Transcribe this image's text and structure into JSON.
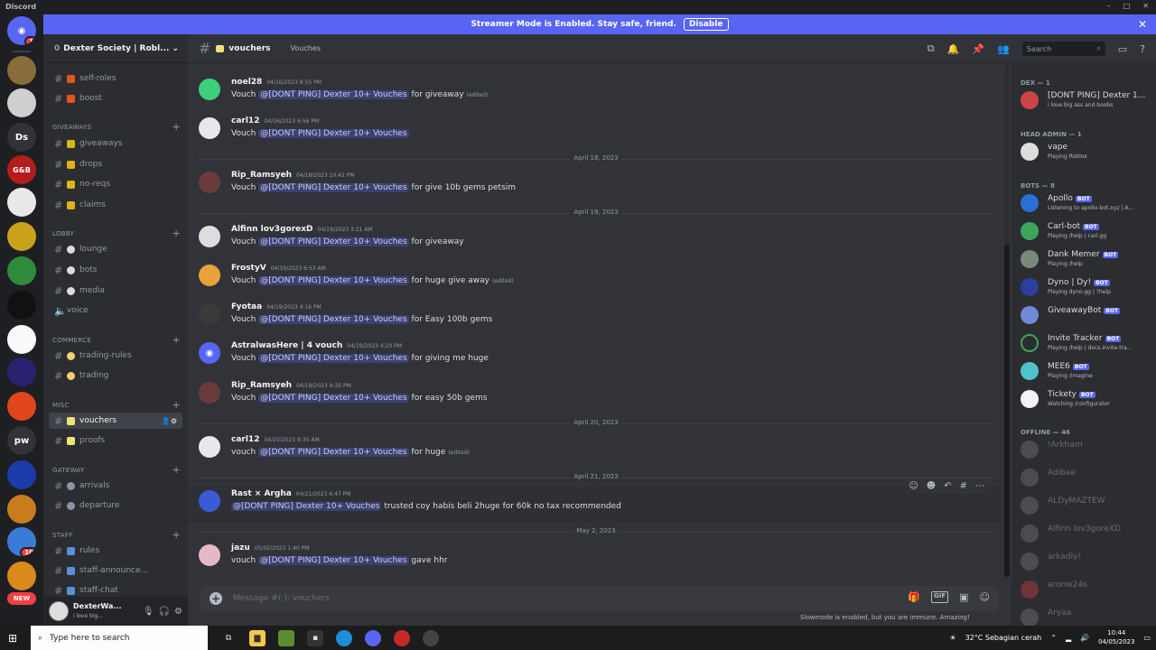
{
  "window": {
    "app_name": "Discord",
    "controls": [
      "–",
      "□",
      "✕"
    ]
  },
  "banner": {
    "text": "Streamer Mode is Enabled. Stay safe, friend.",
    "button": "Disable"
  },
  "server": {
    "name": "Dexter Society | Robl...",
    "mention_count": "0"
  },
  "guild_badges": {
    "home": "1",
    "red1": "10",
    "new": "NEW"
  },
  "guild_labels": {
    "ds": "Ds",
    "pw": "pw",
    "gb": "G&B"
  },
  "channels": [
    {
      "label": "self-roles"
    },
    {
      "label": "boost"
    },
    {
      "label": "giveaways"
    },
    {
      "label": "drops"
    },
    {
      "label": "no-reqs"
    },
    {
      "label": "claims"
    },
    {
      "label": "lounge"
    },
    {
      "label": "bots"
    },
    {
      "label": "media"
    },
    {
      "label": "voice"
    },
    {
      "label": "trading-rules"
    },
    {
      "label": "trading"
    },
    {
      "label": "vouchers"
    },
    {
      "label": "proofs"
    },
    {
      "label": "arrivals"
    },
    {
      "label": "departure"
    },
    {
      "label": "rules"
    },
    {
      "label": "staff-announce..."
    },
    {
      "label": "staff-chat"
    }
  ],
  "categories": {
    "giveaways": "GIVEAWAYS",
    "lobby": "LOBBY",
    "commerce": "COMMERCE",
    "misc": "MISC",
    "gateway": "GATEWAY",
    "staff": "STAFF"
  },
  "user": {
    "name": "DexterWa...",
    "status": "i love big..."
  },
  "chat": {
    "channel": "vouchers",
    "topic": "Vouches",
    "search_placeholder": "Search"
  },
  "mention_text": "@[DONT PING] Dexter 10+ Vouches",
  "edited_label": "(edited)",
  "messages": [
    {
      "user": "noel28",
      "time": "04/16/2023 6:55 PM",
      "prefix": "Vouch",
      "suffix": "for giveaway",
      "edited": true
    },
    {
      "user": "carl12",
      "time": "04/16/2023 6:56 PM",
      "prefix": "Vouch",
      "suffix": "",
      "edited": false
    },
    {
      "user": "Rip_Ramsyeh",
      "time": "04/18/2023 10:42 PM",
      "prefix": "Vouch",
      "suffix": "for give 10b gems petsim",
      "edited": false
    },
    {
      "user": "Alfinn lov3gorexD",
      "time": "04/19/2023 3:21 AM",
      "prefix": "Vouch",
      "suffix": "for giveaway",
      "edited": false
    },
    {
      "user": "FrostyV",
      "time": "04/19/2023 6:53 AM",
      "prefix": "Vouch",
      "suffix": "for huge give away",
      "edited": true
    },
    {
      "user": "Fyotaa",
      "time": "04/19/2023 4:16 PM",
      "prefix": "Vouch",
      "suffix": "for Easy 100b gems",
      "edited": false
    },
    {
      "user": "AstralwasHere | 4 vouch",
      "time": "04/19/2023 4:20 PM",
      "prefix": "Vouch",
      "suffix": "for giving me huge",
      "edited": false
    },
    {
      "user": "Rip_Ramsyeh",
      "time": "04/19/2023 4:35 PM",
      "prefix": "Vouch",
      "suffix": "for easy 50b gems",
      "edited": false
    },
    {
      "user": "carl12",
      "time": "04/20/2023 9:35 AM",
      "prefix": "vouch",
      "suffix": "for huge",
      "edited": true
    },
    {
      "user": "Rast × Argha",
      "time": "04/21/2023 6:47 PM",
      "prefix": "",
      "suffix": "trusted coy habis beli 2huge for 60k no tax recommended",
      "edited": false
    },
    {
      "user": "jazu",
      "time": "05/02/2023 1:40 PM",
      "prefix": "vouch",
      "suffix": "gave hhr",
      "edited": false
    }
  ],
  "dividers": [
    "April 18, 2023",
    "April 19, 2023",
    "April 20, 2023",
    "April 21, 2023",
    "May 2, 2023"
  ],
  "composer": {
    "placeholder": "Message #(     ): vouchers",
    "gif": "GIF"
  },
  "slowmode": "Slowmode is enabled, but you are immune. Amazing!",
  "members": {
    "dex_heading": "DEX — 1",
    "head_admin_heading": "HEAD ADMIN — 1",
    "bots_heading": "BOTS — 8",
    "offline_heading": "OFFLINE — 46",
    "bot_tag": "BOT",
    "dex": [
      {
        "name": "[DONT PING] Dexter 1...",
        "status": "i love big ass and boobs"
      }
    ],
    "head_admin": [
      {
        "name": "vape",
        "status": "Playing Roblox"
      }
    ],
    "bots": [
      {
        "name": "Apollo",
        "status": "Listening to apollo-bot.xyz | A..."
      },
      {
        "name": "Carl-bot",
        "status": "Playing /help | carl.gg"
      },
      {
        "name": "Dank Memer",
        "status": "Playing /help"
      },
      {
        "name": "Dyno | Dy!",
        "status": "Playing dyno.gg | ?help"
      },
      {
        "name": "GiveawayBot",
        "status": ""
      },
      {
        "name": "Invite Tracker",
        "status": "Playing /help | docs.invite-tra..."
      },
      {
        "name": "MEE6",
        "status": "Playing /imagine"
      },
      {
        "name": "Tickety",
        "status": "Watching /configurator"
      }
    ],
    "offline": [
      {
        "name": "!Arkham"
      },
      {
        "name": "Adibae"
      },
      {
        "name": "ALDyMAZTEW"
      },
      {
        "name": "Alfinn lov3goreXD"
      },
      {
        "name": "arkadiy!"
      },
      {
        "name": "aronw24s"
      },
      {
        "name": "Aryaa"
      }
    ]
  },
  "taskbar": {
    "search_placeholder": "Type here to search",
    "weather": "32°C  Sebagian cerah",
    "time": "10:44",
    "date": "04/05/2023"
  }
}
